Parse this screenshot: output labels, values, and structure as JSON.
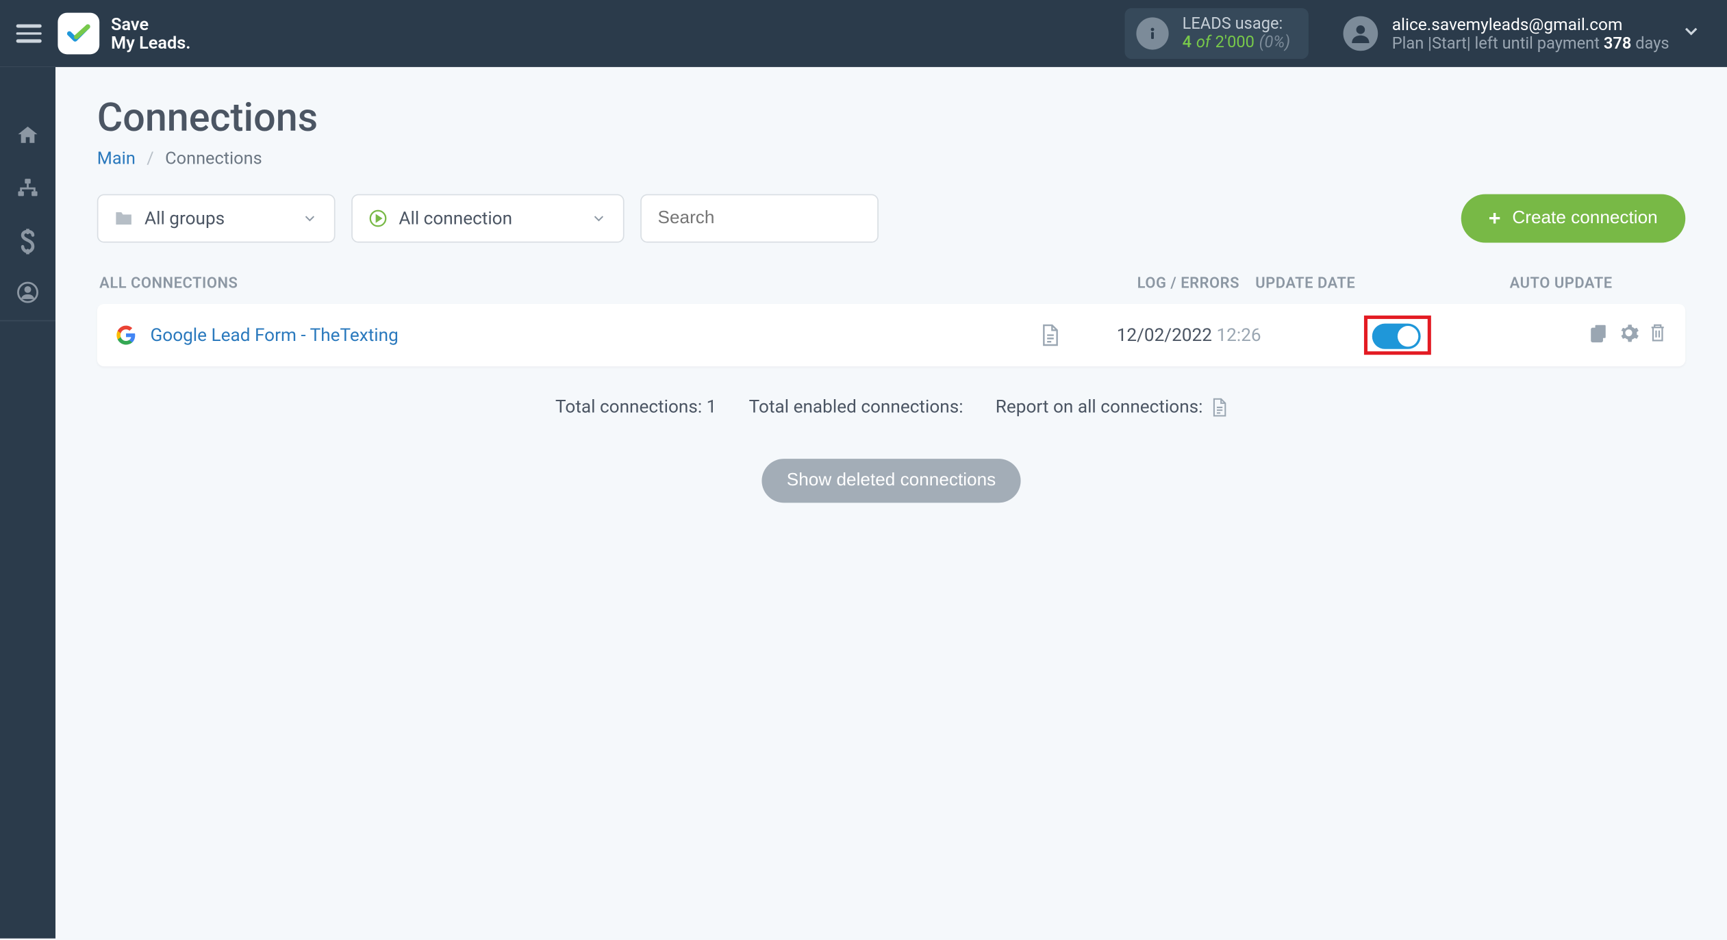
{
  "brand": {
    "line1": "Save",
    "line2": "My Leads."
  },
  "header": {
    "leads_label": "LEADS usage:",
    "leads_used": "4",
    "leads_of": "of",
    "leads_total": "2'000",
    "leads_pct": "(0%)",
    "user_email": "alice.savemyleads@gmail.com",
    "plan_prefix": "Plan ",
    "plan_name": "|Start|",
    "plan_suffix1": " left until payment ",
    "plan_days": "378",
    "plan_suffix2": " days"
  },
  "page": {
    "title": "Connections",
    "breadcrumb_main": "Main",
    "breadcrumb_current": "Connections"
  },
  "filters": {
    "groups": "All groups",
    "connections": "All connection",
    "search_placeholder": "Search",
    "create_btn": "Create connection"
  },
  "table": {
    "col_all": "ALL CONNECTIONS",
    "col_log": "LOG / ERRORS",
    "col_date": "UPDATE DATE",
    "col_auto": "AUTO UPDATE"
  },
  "row": {
    "name": "Google Lead Form - TheTexting",
    "date": "12/02/2022",
    "time": "12:26"
  },
  "stats": {
    "total": "Total connections: 1",
    "enabled": "Total enabled connections:",
    "report": "Report on all connections:"
  },
  "show_deleted": "Show deleted connections"
}
